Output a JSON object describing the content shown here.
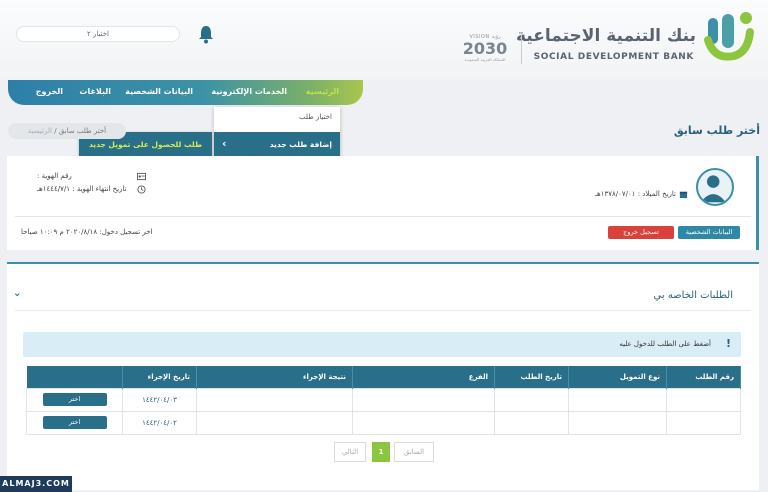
{
  "header": {
    "brand_ar": "بنك التنمية الاجتماعية",
    "brand_en": "SOCIAL DEVELOPMENT BANK",
    "vision_top": "VISION رؤية",
    "vision_year": "2030",
    "vision_bottom": "المملكة العربية السعودية",
    "role_select": "اختيار ٢"
  },
  "nav": {
    "items": [
      "الرئيسية",
      "الخدمات الإلكترونية",
      "البيانات الشخصية",
      "البلاغات",
      "الخروج"
    ],
    "dropdown_choose": "اختيار طلب",
    "dropdown_add": "إضافة طلب جديد",
    "submenu": "طلب للحصول على تمويل جديد"
  },
  "breadcrumb": {
    "home": "الرئيسية",
    "sep": "/",
    "current": "أختر طلب سابق"
  },
  "page_title": "أختر طلب سابق",
  "profile": {
    "birth_date": "تاريخ الميلاد : ١٣٧٨/٠٧/٠١هـ",
    "id_number": "رقم الهوية :",
    "id_expiry": "تاريخ انتهاء الهوية : ١٤٤٤/٧/١هـ",
    "personal_btn": "البيانات الشخصية",
    "logout_btn": "تسجيل خروج",
    "last_login": "اخر تسجيل دخول: ٢٠٢٠/٨/١٨ م ١٠:٠٩ صباحا"
  },
  "requests": {
    "title": "الطلبات الخاصه بي",
    "alert": "أضغط على الطلب للدخول عليه",
    "columns": [
      "رقم الطلب",
      "نوع التمويل",
      "تاريخ الطلب",
      "الفرع",
      "نتيجة الإجراء",
      "تاريخ الإجراء",
      ""
    ],
    "rows": [
      {
        "req_no": "",
        "type": "",
        "req_date": "",
        "branch": "",
        "result": "",
        "action_date": "١٤٤٢/٠٤/٠٣",
        "btn": "اختر"
      },
      {
        "req_no": "",
        "type": "",
        "req_date": "",
        "branch": "",
        "result": "",
        "action_date": "١٤٤٢/٠٤/٠٢",
        "btn": "اختر"
      }
    ]
  },
  "pagination": {
    "prev": "السابق",
    "page": "1",
    "next": "التالي"
  },
  "watermark": "ALMAJ3.COM"
}
